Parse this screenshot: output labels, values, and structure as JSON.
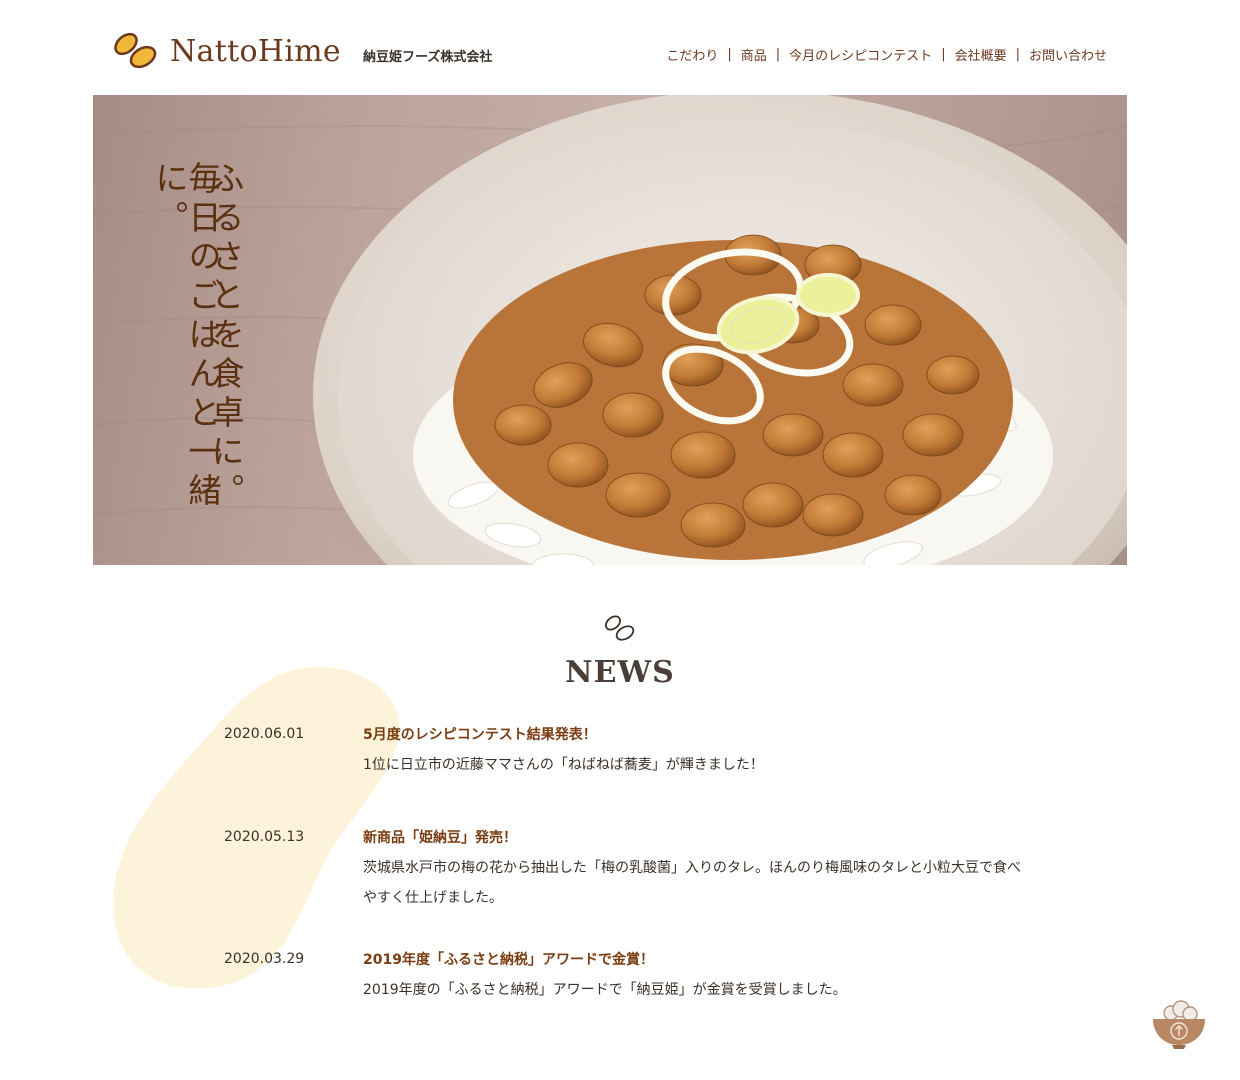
{
  "header": {
    "logo_text": "NattoHime",
    "company": "納豆姫フーズ株式会社",
    "nav": [
      {
        "label": "こだわり"
      },
      {
        "label": "商品"
      },
      {
        "label": "今月のレシピコンテスト"
      },
      {
        "label": "会社概要"
      },
      {
        "label": "お問い合わせ"
      }
    ]
  },
  "hero": {
    "line1": "ふるさとを食卓に。",
    "line2": "毎日のごはんと一緒に。"
  },
  "news": {
    "title": "NEWS",
    "items": [
      {
        "date": "2020.06.01",
        "headline": "5月度のレシピコンテスト結果発表！",
        "text": "1位に日立市の近藤ママさんの「ねばねば蕎麦」が輝きました！"
      },
      {
        "date": "2020.05.13",
        "headline": "新商品「姫納豆」発売！",
        "text": "茨城県水戸市の梅の花から抽出した「梅の乳酸菌」入りのタレ。ほんのり梅風味のタレと小粒大豆で食べやすく仕上げました。"
      },
      {
        "date": "2020.03.29",
        "headline": "2019年度「ふるさと納税」アワードで金賞！",
        "text": "2019年度の「ふるさと納税」アワードで「納豆姫」が金賞を受賞しました。"
      }
    ]
  },
  "colors": {
    "brand_brown": "#6b3a1e",
    "accent_yellow": "#f0b73a",
    "blob_cream": "#fdf3da"
  },
  "icons": {
    "logo": "natto-beans-icon",
    "news": "beans-outline-icon",
    "to_top": "rice-bowl-arrow-up-icon"
  }
}
